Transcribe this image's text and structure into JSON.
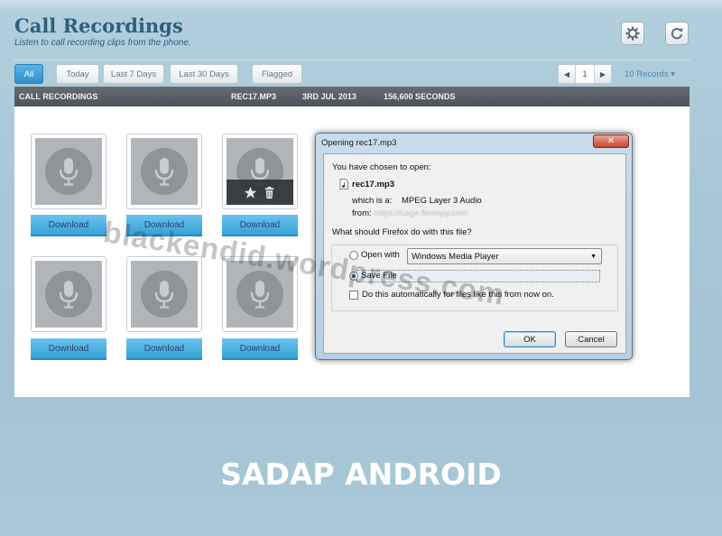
{
  "app": {
    "title": "Call Recordings",
    "subtitle": "Listen to call recording clips from the phone."
  },
  "toolbar": {
    "settings_icon": "gear-icon",
    "refresh_icon": "refresh-icon",
    "filters": [
      "All",
      "Today",
      "Last 7 Days",
      "Last 30 Days",
      "Flagged"
    ],
    "active_filter": "All",
    "page": "1",
    "records_label": "10 Records ▾"
  },
  "header": {
    "section": "CALL RECORDINGS",
    "file": "REC17.MP3",
    "date": "3RD JUL 2013",
    "duration": "156,600 SECONDS"
  },
  "recordings": {
    "download_label": "Download",
    "tile_icon": "microphone-icon",
    "overlay_icons": [
      "star-icon",
      "trash-icon"
    ]
  },
  "dialog": {
    "title": "Opening rec17.mp3",
    "close_label": "✕",
    "intro": "You have chosen to open:",
    "file_name": "rec17.mp3",
    "which_is_label": "which is a:",
    "which_is_value": "MPEG Layer 3 Audio",
    "from_label": "from:",
    "from_value": "https://cage.flexispy.com",
    "question": "What should Firefox do with this file?",
    "open_with_label": "Open with",
    "open_with_app": "Windows Media Player",
    "save_file_label": "Save File",
    "auto_label": "Do this automatically for files like this from now on.",
    "ok_label": "OK",
    "cancel_label": "Cancel"
  },
  "watermark": "blackendid.wordpress.com",
  "caption": "SADAP ANDROID",
  "colors": {
    "background": "#a7c6d6",
    "accent": "#34a2db",
    "title": "#2e5f7c",
    "header_bar": "#55595f"
  }
}
